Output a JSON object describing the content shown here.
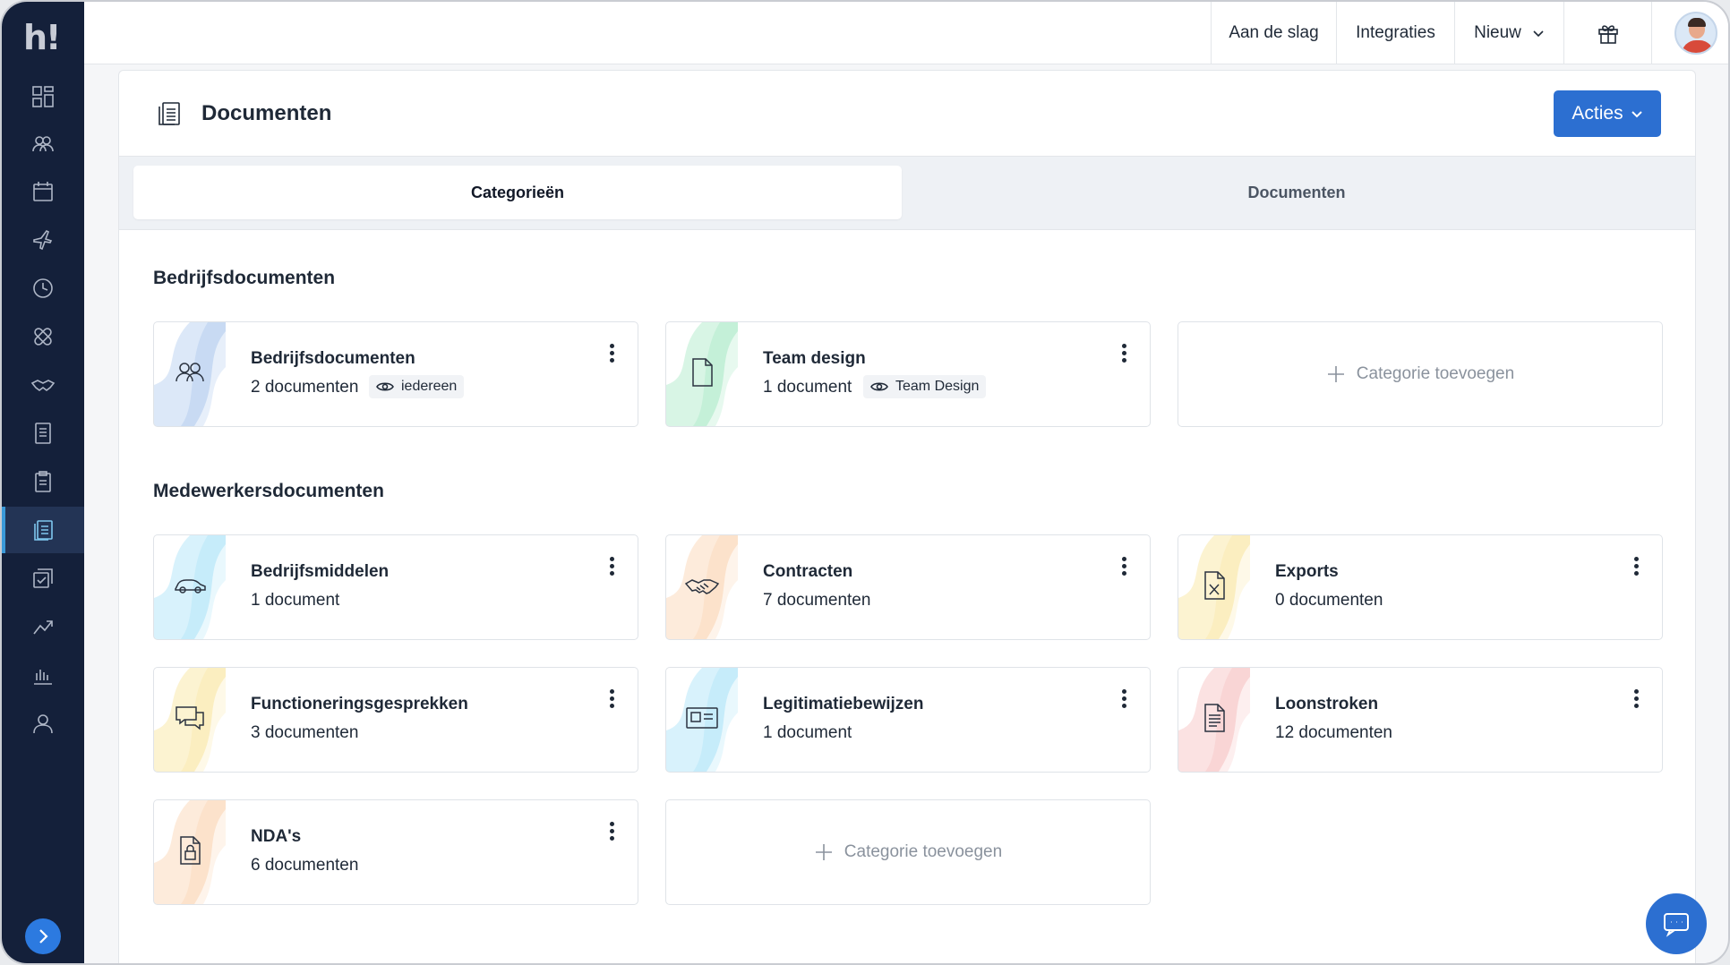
{
  "app": {
    "logo_text": "h!"
  },
  "topbar": {
    "items": [
      {
        "label": "Aan de slag"
      },
      {
        "label": "Integraties"
      },
      {
        "label": "Nieuw"
      }
    ]
  },
  "page": {
    "title": "Documenten",
    "actions_label": "Acties"
  },
  "tabs": [
    {
      "label": "Categorieën",
      "active": true
    },
    {
      "label": "Documenten",
      "active": false
    }
  ],
  "sections": [
    {
      "title": "Bedrijfsdocumenten",
      "cards": [
        {
          "name": "Bedrijfsdocumenten",
          "count": "2 documenten",
          "badge": "iedereen",
          "icon": "people-icon",
          "color": "#3d7fd6"
        },
        {
          "name": "Team design",
          "count": "1 document",
          "badge": "Team Design",
          "icon": "document-icon",
          "color": "#3ccf7f"
        }
      ],
      "add_label": "Categorie toevoegen"
    },
    {
      "title": "Medewerkersdocumenten",
      "cards": [
        {
          "name": "Bedrijfsmiddelen",
          "count": "1 document",
          "icon": "car-icon",
          "color": "#4cc3f0"
        },
        {
          "name": "Contracten",
          "count": "7 documenten",
          "icon": "handshake-icon",
          "color": "#f5a55a"
        },
        {
          "name": "Exports",
          "count": "0 documenten",
          "icon": "excel-file-icon",
          "color": "#f5d45a"
        },
        {
          "name": "Functioneringsgesprekken",
          "count": "3 documenten",
          "icon": "chat-bubbles-icon",
          "color": "#f5d45a"
        },
        {
          "name": "Legitimatiebewijzen",
          "count": "1 document",
          "icon": "id-card-icon",
          "color": "#4cc3f0"
        },
        {
          "name": "Loonstroken",
          "count": "12 documenten",
          "icon": "payslip-icon",
          "color": "#ee7b7b"
        },
        {
          "name": "NDA's",
          "count": "6 documenten",
          "icon": "locked-file-icon",
          "color": "#f5a55a"
        }
      ],
      "add_label": "Categorie toevoegen"
    }
  ],
  "colors": {
    "sidebar": "#14203a",
    "accent": "#2c6fd1"
  }
}
